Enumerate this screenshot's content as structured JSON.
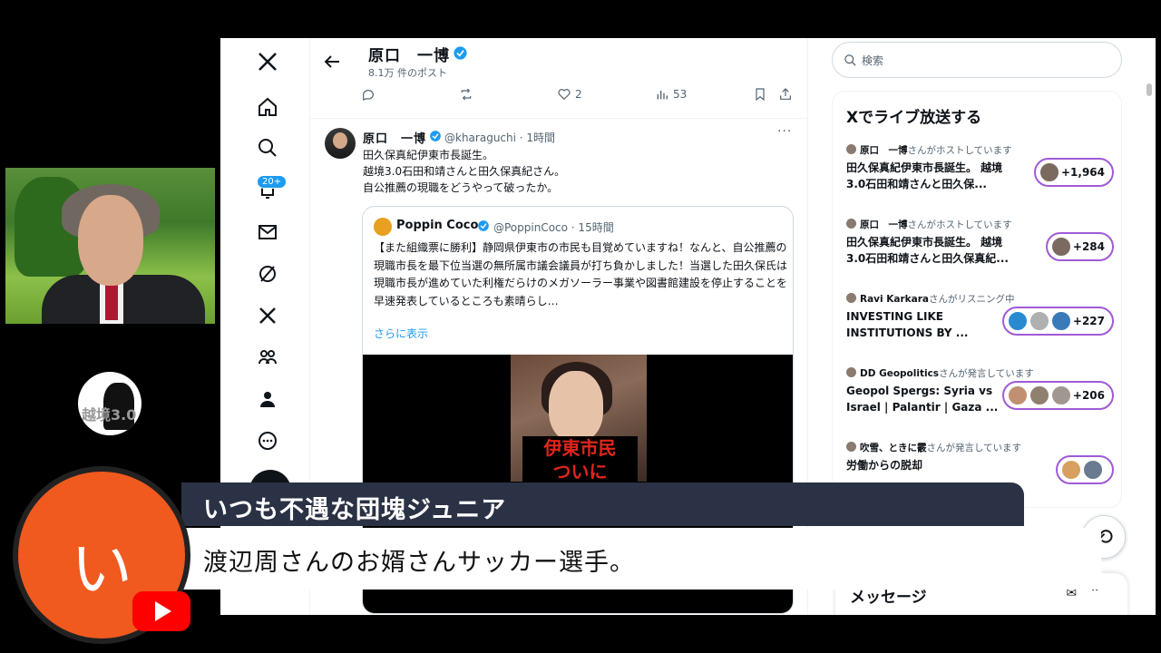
{
  "profile_header": {
    "name": "原口　一博",
    "post_count": "8.1万 件のポスト"
  },
  "top_actions": {
    "likes": "2",
    "views": "53"
  },
  "nav": {
    "notifications_badge": "20+"
  },
  "tweet": {
    "name": "原口　一博",
    "handle_time": "@kharaguchi · 1時間",
    "more": "···",
    "text_lines": [
      "田久保真紀伊東市長誕生。",
      "越境3.0石田和靖さんと田久保真紀さん。",
      "自公推薦の現職をどうやって破ったか。"
    ]
  },
  "quote": {
    "name": "Poppin Coco",
    "handle_time": "@PoppinCoco · 15時間",
    "text": "【また組織票に勝利】静岡県伊東市の市民も目覚めていますね！なんと、自公推薦の現職市長を最下位当選の無所属市議会議員が打ち負かしました！当選した田久保氏は現職市長が進めていた利権だらけのメガソーラー事業や図書館建設を停止することを早速発表しているところも素晴らし…",
    "show_more": "さらに表示",
    "media_caption_1": "伊東市民",
    "media_caption_2": "ついに"
  },
  "sidebar": {
    "search_placeholder": "検索",
    "live_title": "Xでライブ放送する",
    "spaces": [
      {
        "host": "原口　一博",
        "host_suffix": "さんがホストしています",
        "title": "田久保真紀伊東市長誕生。 越境3.0石田和靖さんと田久保...",
        "count": "+1,964"
      },
      {
        "host": "原口　一博",
        "host_suffix": "さんがホストしています",
        "title": "田久保真紀伊東市長誕生。 越境3.0石田和靖さんと田久保真紀...",
        "count": "+284"
      },
      {
        "host": "Ravi Karkara",
        "host_suffix": "さんがリスニング中",
        "title": "INVESTING LIKE INSTITUTIONS BY ...",
        "count": "+227"
      },
      {
        "host": "DD Geopolitics",
        "host_suffix": "さんが発言しています",
        "title": "Geopol Spergs: Syria vs Israel | Palantir | Gaza ...",
        "count": "+206"
      },
      {
        "host": "吹雪、ときに霰",
        "host_suffix": "さんが発言しています",
        "title": "労働からの脱却",
        "count": ""
      }
    ],
    "messages_label": "メッセージ"
  },
  "overlay": {
    "channel_initial": "い",
    "channel_name": "いつも不遇な団塊ジュニア",
    "comment": "渡辺周さんのお婿さんサッカー選手。",
    "logo_text": "越境3.0"
  },
  "colors": {
    "accent": "#1d9bf0",
    "orange": "#f05a1e",
    "banner_dark": "#2b3245",
    "youtube_red": "#ff0000",
    "pill_border": "#a05ad6"
  }
}
